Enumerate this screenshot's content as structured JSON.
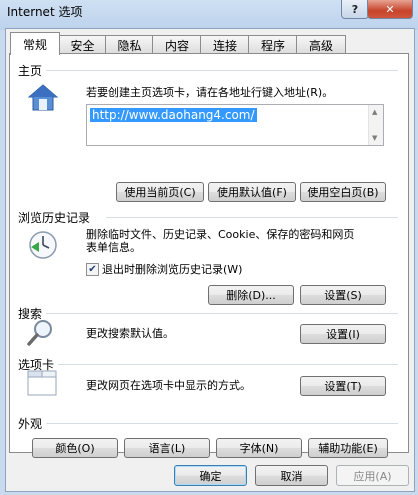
{
  "window": {
    "title": "Internet 选项",
    "help_glyph": "?",
    "close_glyph": "✕"
  },
  "tabs": [
    {
      "label": "常规",
      "active": true
    },
    {
      "label": "安全"
    },
    {
      "label": "隐私"
    },
    {
      "label": "内容"
    },
    {
      "label": "连接"
    },
    {
      "label": "程序"
    },
    {
      "label": "高级"
    }
  ],
  "homepage": {
    "group_label": "主页",
    "description": "若要创建主页选项卡，请在各地址行键入地址(R)。",
    "url": "http://www.daohang4.com/",
    "buttons": {
      "use_current": "使用当前页(C)",
      "use_default": "使用默认值(F)",
      "use_blank": "使用空白页(B)"
    }
  },
  "history": {
    "group_label": "浏览历史记录",
    "description_line1": "删除临时文件、历史记录、Cookie、保存的密码和网页",
    "description_line2": "表单信息。",
    "checkbox_label": "退出时删除浏览历史记录(W)",
    "checkbox_checked": true,
    "buttons": {
      "delete": "删除(D)...",
      "settings": "设置(S)"
    }
  },
  "search": {
    "group_label": "搜索",
    "description": "更改搜索默认值。",
    "buttons": {
      "settings": "设置(I)"
    }
  },
  "tabbed": {
    "group_label": "选项卡",
    "description": "更改网页在选项卡中显示的方式。",
    "buttons": {
      "settings": "设置(T)"
    }
  },
  "appearance": {
    "group_label": "外观",
    "buttons": {
      "colors": "颜色(O)",
      "languages": "语言(L)",
      "fonts": "字体(N)",
      "accessibility": "辅助功能(E)"
    }
  },
  "footer": {
    "ok": "确定",
    "cancel": "取消",
    "apply": "应用(A)"
  }
}
